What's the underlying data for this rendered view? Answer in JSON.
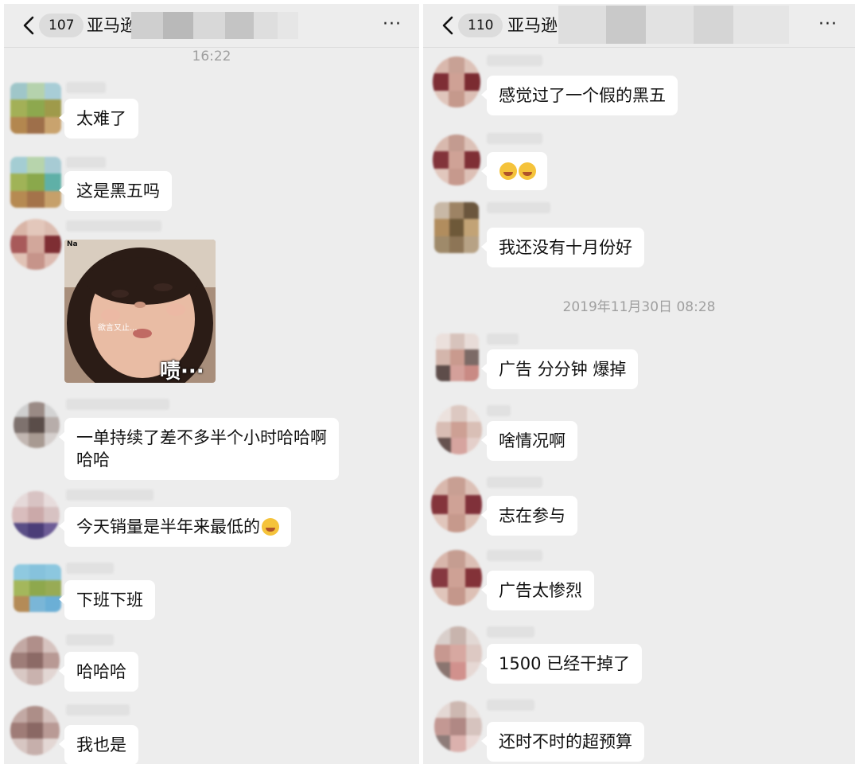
{
  "left": {
    "nav": {
      "back_label": "<",
      "badge": "107",
      "title": "亚马逊",
      "more": "···"
    },
    "timestamp": "16:22",
    "messages": [
      {
        "text": "太难了"
      },
      {
        "text": "这是黑五吗"
      },
      {
        "sticker": {
          "top_label": "Na",
          "caption": "欲言又止...",
          "big_text": "啧···"
        }
      },
      {
        "text_line1": "一单持续了差不多半个小时哈哈啊",
        "text_line2": "哈哈"
      },
      {
        "text": "今天销量是半年来最低的",
        "emoji": "cry-laugh-icon"
      },
      {
        "text": "下班下班"
      },
      {
        "text": "哈哈哈"
      },
      {
        "text": "我也是"
      }
    ]
  },
  "right": {
    "nav": {
      "back_label": "<",
      "badge": "110",
      "title": "亚马逊",
      "more": "···"
    },
    "timestamp": "2019年11月30日 08:28",
    "messages": [
      {
        "text": "感觉过了一个假的黑五"
      },
      {
        "emoji": "grin-squint-icon"
      },
      {
        "text": "我还没有十月份好"
      },
      {
        "text": "广告 分分钟 爆掉"
      },
      {
        "text": "啥情况啊"
      },
      {
        "text": "志在参与"
      },
      {
        "text": "广告太惨烈"
      },
      {
        "text": "1500 已经干掉了"
      },
      {
        "text": "还时不时的超预算"
      }
    ]
  },
  "colors": {
    "background": "#ededed",
    "bubble": "#ffffff",
    "timestamp": "#9f9f9f",
    "text": "#111111"
  }
}
